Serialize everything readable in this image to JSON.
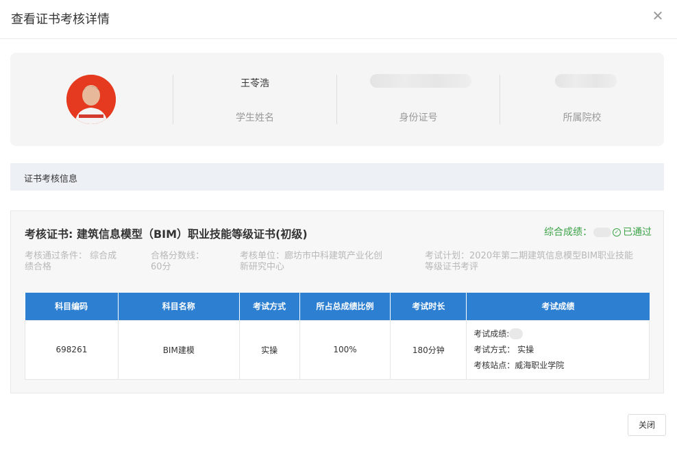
{
  "modal": {
    "title": "查看证书考核详情",
    "close_label": "关闭"
  },
  "profile": {
    "student_name": "王苓浩",
    "name_label": "学生姓名",
    "id_label": "身份证号",
    "school_label": "所属院校"
  },
  "section": {
    "title": "证书考核信息"
  },
  "cert": {
    "name": "考核证书: 建筑信息模型（BIM）职业技能等级证书(初级)",
    "score_label": "综合成绩：",
    "status": "已通过",
    "pass_condition": [
      "考核通过条件： 综合成",
      "绩合格"
    ],
    "pass_score": [
      "合格分数线：",
      "60分"
    ],
    "unit": [
      "考核单位：廊坊市中科建筑产业化创",
      "新研究中心"
    ],
    "plan": [
      "考试计划：2020年第二期建筑信息模型BIM职业技能",
      "等级证书考评"
    ]
  },
  "table": {
    "headers": [
      "科目编码",
      "科目名称",
      "考试方式",
      "所占总成绩比例",
      "考试时长",
      "考试成绩"
    ],
    "rows": [
      {
        "code": "698261",
        "subject": "BIM建模",
        "method": "实操",
        "ratio": "100%",
        "duration": "180分钟",
        "result_score_label": "考试成绩:",
        "result_method": "考试方式： 实操",
        "result_site": "考核站点：威海职业学院"
      }
    ]
  },
  "colors": {
    "accent": "#2d7fd2",
    "success": "#3aa245",
    "avatar_bg": "#e53a1f"
  },
  "icons": {
    "close": "close-icon",
    "check": "check-circle-icon"
  }
}
